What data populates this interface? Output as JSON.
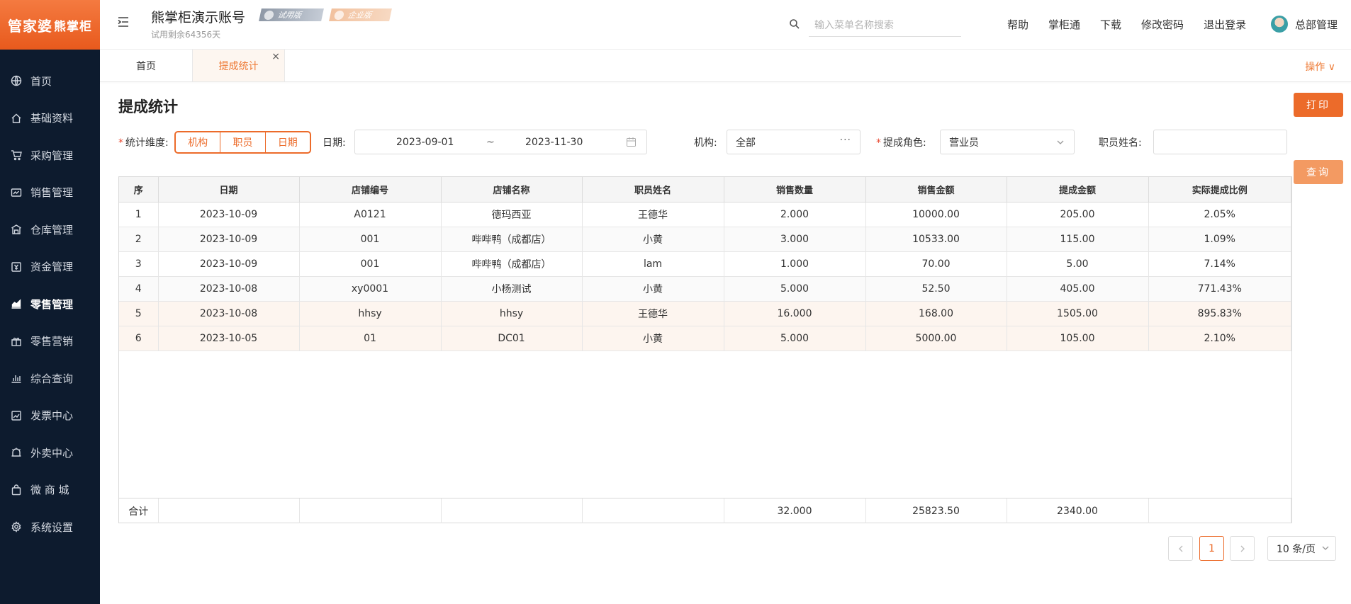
{
  "sidebar": {
    "logo_main": "管家婆",
    "logo_sub": "熊掌柜",
    "items": [
      {
        "label": "首页",
        "icon": "globe-icon"
      },
      {
        "label": "基础资料",
        "icon": "home-icon"
      },
      {
        "label": "采购管理",
        "icon": "cart-icon"
      },
      {
        "label": "销售管理",
        "icon": "sales-icon"
      },
      {
        "label": "仓库管理",
        "icon": "warehouse-icon"
      },
      {
        "label": "资金管理",
        "icon": "finance-icon"
      },
      {
        "label": "零售管理",
        "icon": "chart-icon",
        "active": true
      },
      {
        "label": "零售营销",
        "icon": "gift-icon"
      },
      {
        "label": "综合查询",
        "icon": "bar-chart-icon"
      },
      {
        "label": "发票中心",
        "icon": "invoice-icon"
      },
      {
        "label": "外卖中心",
        "icon": "delivery-icon"
      },
      {
        "label": "微 商 城",
        "icon": "bag-icon"
      },
      {
        "label": "系统设置",
        "icon": "gear-icon"
      }
    ]
  },
  "header": {
    "account_title": "熊掌柜演示账号",
    "badge_trial": "试用版",
    "badge_enterprise": "企业版",
    "trial_remaining": "试用剩余64356天",
    "search_placeholder": "输入菜单名称搜索",
    "links": [
      "帮助",
      "掌柜通",
      "下载",
      "修改密码",
      "退出登录"
    ],
    "user_name": "总部管理"
  },
  "tabs": {
    "home": "首页",
    "active": "提成统计",
    "close": "×",
    "ops": "操作 ∨"
  },
  "page": {
    "title": "提成统计",
    "print_btn": "打印",
    "query_btn": "查询"
  },
  "filters": {
    "dimension_label": "统计维度:",
    "dimension_options": [
      "机构",
      "职员",
      "日期"
    ],
    "date_label": "日期:",
    "date_from": "2023-09-01",
    "date_sep": "~",
    "date_to": "2023-11-30",
    "org_label": "机构:",
    "org_value": "全部",
    "org_more": "···",
    "role_label": "提成角色:",
    "role_value": "营业员",
    "staff_label": "职员姓名:",
    "staff_value": ""
  },
  "table": {
    "headers": [
      "序",
      "日期",
      "店铺编号",
      "店铺名称",
      "职员姓名",
      "销售数量",
      "销售金额",
      "提成金额",
      "实际提成比例"
    ],
    "rows": [
      [
        "1",
        "2023-10-09",
        "A0121",
        "德玛西亚",
        "王德华",
        "2.000",
        "10000.00",
        "205.00",
        "2.05%"
      ],
      [
        "2",
        "2023-10-09",
        "001",
        "哔哔鸭（成都店）",
        "小黄",
        "3.000",
        "10533.00",
        "115.00",
        "1.09%"
      ],
      [
        "3",
        "2023-10-09",
        "001",
        "哔哔鸭（成都店）",
        "lam",
        "1.000",
        "70.00",
        "5.00",
        "7.14%"
      ],
      [
        "4",
        "2023-10-08",
        "xy0001",
        "小杨测试",
        "小黄",
        "5.000",
        "52.50",
        "405.00",
        "771.43%"
      ],
      [
        "5",
        "2023-10-08",
        "hhsy",
        "hhsy",
        "王德华",
        "16.000",
        "168.00",
        "1505.00",
        "895.83%"
      ],
      [
        "6",
        "2023-10-05",
        "01",
        "DC01",
        "小黄",
        "5.000",
        "5000.00",
        "105.00",
        "2.10%"
      ]
    ],
    "summary": [
      "合计",
      "",
      "",
      "",
      "",
      "32.000",
      "25823.50",
      "2340.00",
      ""
    ]
  },
  "pagination": {
    "current": "1",
    "page_size": "10 条/页"
  },
  "colors": {
    "accent": "#ec6b2a",
    "sidebar_bg": "#0d1b2e"
  }
}
